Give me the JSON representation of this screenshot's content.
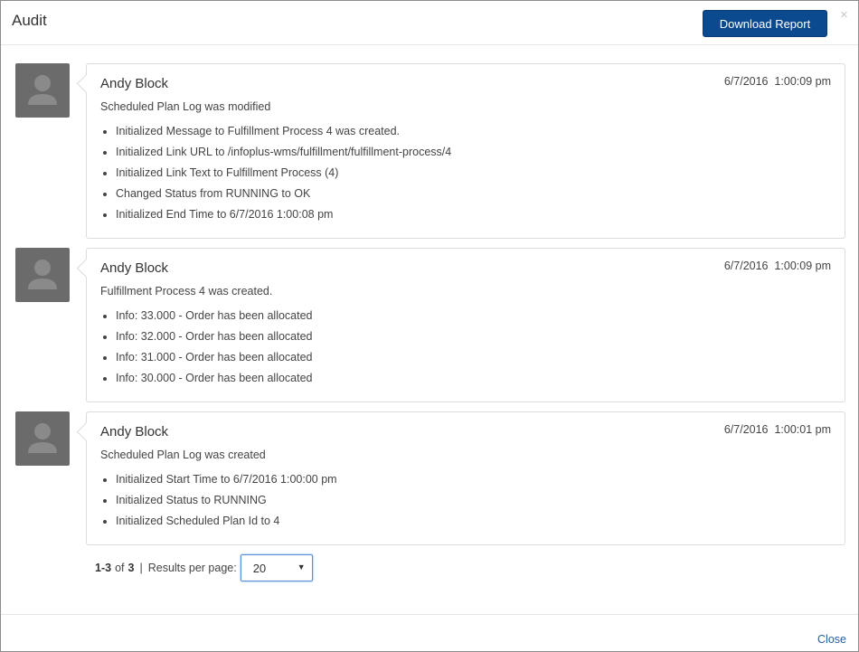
{
  "header": {
    "title": "Audit",
    "download_label": "Download Report",
    "close_glyph": "×"
  },
  "entries": [
    {
      "author": "Andy Block",
      "timestamp": "6/7/2016  1:00:09 pm",
      "summary": "Scheduled Plan Log was modified",
      "changes": [
        "Initialized Message to Fulfillment Process 4 was created.",
        "Initialized Link URL to /infoplus-wms/fulfillment/fulfillment-process/4",
        "Initialized Link Text to Fulfillment Process (4)",
        "Changed Status from RUNNING to OK",
        "Initialized End Time to 6/7/2016 1:00:08 pm"
      ]
    },
    {
      "author": "Andy Block",
      "timestamp": "6/7/2016  1:00:09 pm",
      "summary": "Fulfillment Process 4 was created.",
      "changes": [
        "Info: 33.000 - Order has been allocated",
        "Info: 32.000 - Order has been allocated",
        "Info: 31.000 - Order has been allocated",
        "Info: 30.000 - Order has been allocated"
      ]
    },
    {
      "author": "Andy Block",
      "timestamp": "6/7/2016  1:00:01 pm",
      "summary": "Scheduled Plan Log was created",
      "changes": [
        "Initialized Start Time to 6/7/2016 1:00:00 pm",
        "Initialized Status to RUNNING",
        "Initialized Scheduled Plan Id to 4"
      ]
    }
  ],
  "pagination": {
    "range": "1-3",
    "of_label": "of",
    "total": "3",
    "separator": "|",
    "per_page_label": "Results per page:",
    "per_page_value": "20"
  },
  "footer": {
    "close_label": "Close"
  },
  "icons": {
    "avatar": "user-placeholder-icon",
    "dropdown": "caret-down-icon",
    "close": "close-icon"
  },
  "colors": {
    "primary_button": "#0b4a8f",
    "avatar_bg": "#6b6b6b",
    "link": "#1f5fa8"
  }
}
